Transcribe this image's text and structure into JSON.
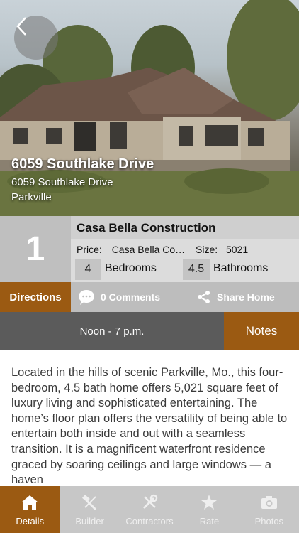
{
  "hero": {
    "title": "6059 Southlake Drive",
    "address": "6059 Southlake Drive",
    "city": "Parkville"
  },
  "listing": {
    "lot_number": "1",
    "builder_name": "Casa Bella Construction",
    "price_label": "Price:",
    "price_value": "Casa Bella Co…",
    "size_label": "Size:",
    "size_value": "5021",
    "bedrooms_count": "4",
    "bedrooms_label": "Bedrooms",
    "bathrooms_count": "4.5",
    "bathrooms_label": "Bathrooms"
  },
  "actions": {
    "directions": "Directions",
    "comments": "0 Comments",
    "share": "Share Home"
  },
  "hours": {
    "text": "Noon - 7 p.m.",
    "notes_label": "Notes"
  },
  "description": "Located in the hills of scenic Parkville, Mo., this four-bedroom, 4.5 bath home offers 5,021 square feet of luxury living and sophisticated entertaining. The home’s floor plan offers the versatility of being able to entertain both inside and out with a seamless transition. It is a magnificent waterfront residence graced by soaring ceilings and large windows — a haven",
  "tabs": [
    {
      "label": "Details",
      "icon": "home-icon",
      "active": true
    },
    {
      "label": "Builder",
      "icon": "builder-icon",
      "active": false
    },
    {
      "label": "Contractors",
      "icon": "tools-icon",
      "active": false
    },
    {
      "label": "Rate",
      "icon": "star-icon",
      "active": false
    },
    {
      "label": "Photos",
      "icon": "camera-icon",
      "active": false
    }
  ],
  "colors": {
    "accent": "#9b5a12",
    "panel_gray": "#dcdcdc",
    "dark_gray": "#5b5b5b",
    "tab_gray": "#c7c7c7"
  }
}
